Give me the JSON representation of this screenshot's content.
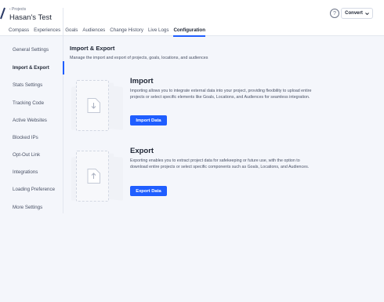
{
  "header": {
    "back_link": "‹ Projects",
    "project_title": "Hasan's Test",
    "help_icon": "?",
    "convert_label": "Convert"
  },
  "nav": {
    "tabs": [
      {
        "label": "Compass",
        "active": false
      },
      {
        "label": "Experiences",
        "active": false
      },
      {
        "label": "Goals",
        "active": false
      },
      {
        "label": "Audiences",
        "active": false
      },
      {
        "label": "Change History",
        "active": false
      },
      {
        "label": "Live Logs",
        "active": false
      },
      {
        "label": "Configuration",
        "active": true
      }
    ]
  },
  "sidebar": {
    "items": [
      {
        "label": "General Settings"
      },
      {
        "label": "Import & Export"
      },
      {
        "label": "Stats Settings"
      },
      {
        "label": "Tracking Code"
      },
      {
        "label": "Active Websites"
      },
      {
        "label": "Blocked IPs"
      },
      {
        "label": "Opt-Out Link"
      },
      {
        "label": "Integrations"
      },
      {
        "label": "Loading Preference"
      },
      {
        "label": "More Settings"
      }
    ],
    "active_index": 1
  },
  "main": {
    "title": "Import & Export",
    "description": "Manage the import and export of projects, goals, locations, and audiences",
    "import": {
      "title": "Import",
      "text": "Importing allows you to integrate external data into your project, providing flexibility to upload entire projects or select specific elements like Goals, Locations, and Audiences for seamless integration.",
      "button": "Import Data",
      "icon": "file-import-icon"
    },
    "export": {
      "title": "Export",
      "text": "Exporting enables you to extract project data for safekeeping or future use, with the option to download entire projects or select specific components such as Goals, Locations, and Audiences.",
      "button": "Export Data",
      "icon": "file-export-icon"
    }
  },
  "colors": {
    "accent": "#1f5eff",
    "background": "#f4f6fb",
    "text": "#1d2433",
    "muted": "#4a5266"
  }
}
